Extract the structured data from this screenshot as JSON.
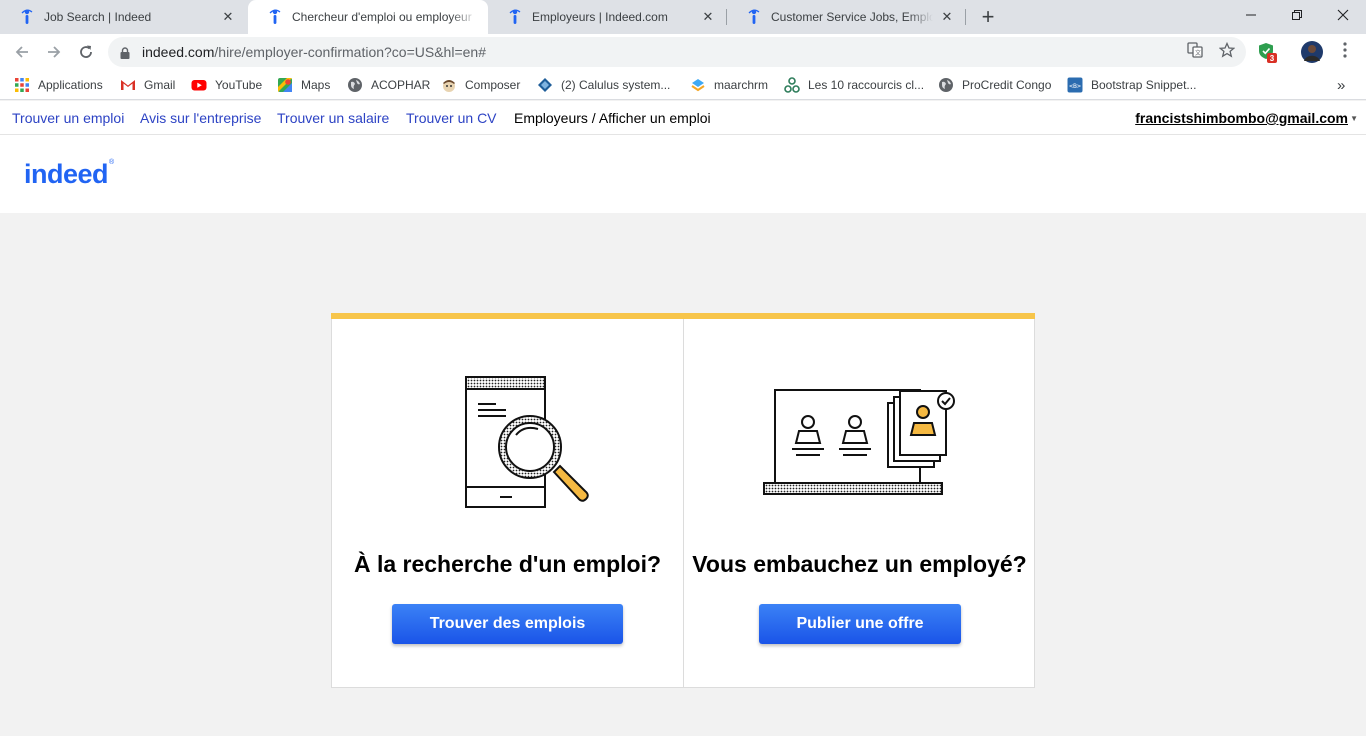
{
  "browser": {
    "tabs": [
      {
        "title": "Job Search | Indeed",
        "icon": "indeed-favicon",
        "active": false
      },
      {
        "title": "Chercheur d'emploi ou employeur",
        "icon": "indeed-favicon",
        "active": true
      },
      {
        "title": "Employeurs | Indeed.com",
        "icon": "indeed-favicon",
        "active": false
      },
      {
        "title": "Customer Service Jobs, Employment",
        "icon": "indeed-favicon",
        "active": false
      }
    ],
    "new_tab_label": "+",
    "window_controls": {
      "minimize": "—",
      "restore": "❐",
      "close": "✕"
    },
    "address_bar": {
      "host": "indeed.com",
      "path": "/hire/employer-confirmation?co=US&hl=en#"
    },
    "extension_badge": "3",
    "bookmarks": [
      {
        "label": "Applications",
        "icon": "apps-grid-icon"
      },
      {
        "label": "Gmail",
        "icon": "gmail-icon"
      },
      {
        "label": "YouTube",
        "icon": "youtube-icon"
      },
      {
        "label": "Maps",
        "icon": "maps-icon"
      },
      {
        "label": "ACOPHAR",
        "icon": "globe-icon"
      },
      {
        "label": "Composer",
        "icon": "composer-icon"
      },
      {
        "label": "(2) Calulus system...",
        "icon": "calulus-icon"
      },
      {
        "label": "maarchrm",
        "icon": "maarchrm-icon"
      },
      {
        "label": "Les 10 raccourcis cl...",
        "icon": "share-icon"
      },
      {
        "label": "ProCredit Congo",
        "icon": "globe-icon"
      },
      {
        "label": "Bootstrap Snippet...",
        "icon": "bootstrap-icon"
      }
    ],
    "bookmarks_overflow": "»"
  },
  "site_nav": {
    "links": [
      "Trouver un emploi",
      "Avis sur l'entreprise",
      "Trouver un salaire",
      "Trouver un CV"
    ],
    "current": "Employeurs / Afficher un emploi",
    "account_email": "francistshimbombo@gmail.com"
  },
  "logo": {
    "text": "indeed",
    "reg": "®",
    "color": "#2164f3"
  },
  "cards": [
    {
      "heading": "À la recherche d'un emploi?",
      "button": "Trouver des emplois",
      "illustration": "phone-magnifier-icon"
    },
    {
      "heading": "Vous embauchez un employé?",
      "button": "Publier une offre",
      "illustration": "hiring-board-icon"
    }
  ],
  "colors": {
    "accent_bar": "#f7c54a",
    "button": "#1a54e8",
    "link": "#2d43c4",
    "illustration_accent": "#f5b942"
  }
}
